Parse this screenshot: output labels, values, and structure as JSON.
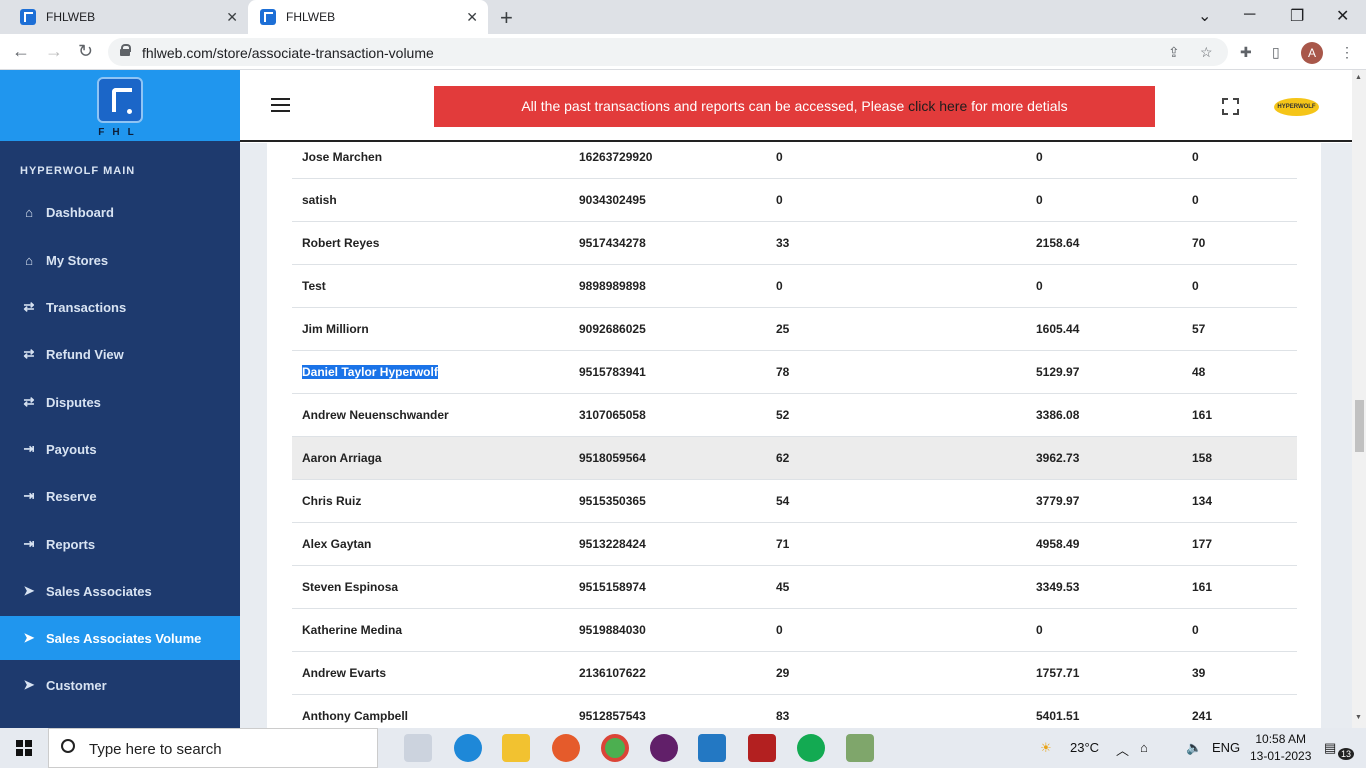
{
  "browser": {
    "tabs": [
      {
        "title": "FHLWEB"
      },
      {
        "title": "FHLWEB"
      }
    ],
    "url": "fhlweb.com/store/associate-transaction-volume",
    "profile_initial": "A"
  },
  "sidebar": {
    "logo_text": "FHL",
    "section_title": "HYPERWOLF MAIN",
    "items": [
      {
        "label": "Dashboard",
        "icon": "home-icon"
      },
      {
        "label": "My Stores",
        "icon": "home-icon"
      },
      {
        "label": "Transactions",
        "icon": "arrows-icon"
      },
      {
        "label": "Refund View",
        "icon": "arrows-icon"
      },
      {
        "label": "Disputes",
        "icon": "arrows-icon"
      },
      {
        "label": "Payouts",
        "icon": "sign-in-icon"
      },
      {
        "label": "Reserve",
        "icon": "sign-in-icon"
      },
      {
        "label": "Reports",
        "icon": "sign-in-icon"
      },
      {
        "label": "Sales Associates",
        "icon": "paper-plane-icon"
      },
      {
        "label": "Sales Associates Volume",
        "icon": "paper-plane-icon"
      },
      {
        "label": "Customer",
        "icon": "paper-plane-icon"
      }
    ]
  },
  "banner": {
    "text_before": "All the past transactions and reports can be accessed, Please ",
    "link": "click here",
    "text_after": " for more detials"
  },
  "brand_logo": "HYPERWOLF",
  "table": {
    "rows": [
      {
        "name": "Jose Marchen",
        "phone": "16263729920",
        "count": "0",
        "amount": "0",
        "c5": "0"
      },
      {
        "name": "satish",
        "phone": "9034302495",
        "count": "0",
        "amount": "0",
        "c5": "0"
      },
      {
        "name": "Robert Reyes",
        "phone": "9517434278",
        "count": "33",
        "amount": "2158.64",
        "c5": "70"
      },
      {
        "name": "Test",
        "phone": "9898989898",
        "count": "0",
        "amount": "0",
        "c5": "0"
      },
      {
        "name": "Jim Milliorn",
        "phone": "9092686025",
        "count": "25",
        "amount": "1605.44",
        "c5": "57"
      },
      {
        "name": "Daniel Taylor Hyperwolf",
        "phone": "9515783941",
        "count": "78",
        "amount": "5129.97",
        "c5": "48"
      },
      {
        "name": "Andrew Neuenschwander",
        "phone": "3107065058",
        "count": "52",
        "amount": "3386.08",
        "c5": "161"
      },
      {
        "name": "Aaron Arriaga",
        "phone": "9518059564",
        "count": "62",
        "amount": "3962.73",
        "c5": "158"
      },
      {
        "name": "Chris Ruiz",
        "phone": "9515350365",
        "count": "54",
        "amount": "3779.97",
        "c5": "134"
      },
      {
        "name": "Alex Gaytan",
        "phone": "9513228424",
        "count": "71",
        "amount": "4958.49",
        "c5": "177"
      },
      {
        "name": "Steven Espinosa",
        "phone": "9515158974",
        "count": "45",
        "amount": "3349.53",
        "c5": "161"
      },
      {
        "name": "Katherine Medina",
        "phone": "9519884030",
        "count": "0",
        "amount": "0",
        "c5": "0"
      },
      {
        "name": "Andrew Evarts",
        "phone": "2136107622",
        "count": "29",
        "amount": "1757.71",
        "c5": "39"
      },
      {
        "name": "Anthony Campbell",
        "phone": "9512857543",
        "count": "83",
        "amount": "5401.51",
        "c5": "241"
      }
    ]
  },
  "taskbar": {
    "search_placeholder": "Type here to search",
    "temperature": "23°C",
    "language": "ENG",
    "time": "10:58 AM",
    "date": "13-01-2023",
    "notification_count": "13"
  }
}
